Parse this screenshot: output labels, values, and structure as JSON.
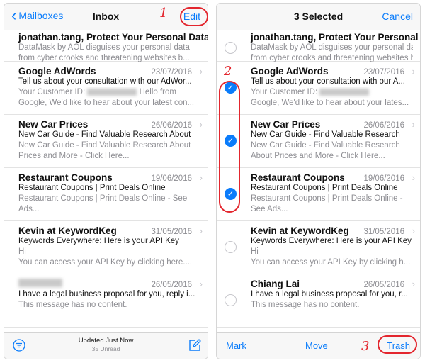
{
  "inbox": {
    "back_label": "Mailboxes",
    "title": "Inbox",
    "edit_label": "Edit",
    "messages": [
      {
        "sender": "jonathan.tang, Protect Your Personal Data",
        "date": "",
        "subject": "",
        "preview1": "DataMask by AOL disguises your personal data",
        "preview2": "from cyber crooks and threatening websites b..."
      },
      {
        "sender": "Google AdWords",
        "date": "23/07/2016",
        "subject": "Tell us about your consultation with our AdWor...",
        "preview1": "Your Customer ID:",
        "preview1b": "Hello from",
        "preview2": "Google, We'd like to hear about your latest con..."
      },
      {
        "sender": "New Car Prices",
        "date": "26/06/2016",
        "subject": "New Car Guide - Find Valuable Research About",
        "preview1": "New Car Guide - Find Valuable Research About",
        "preview2": "Prices and More - Click Here..."
      },
      {
        "sender": "Restaurant Coupons",
        "date": "19/06/2016",
        "subject": "Restaurant Coupons | Print Deals Online",
        "preview1": "Restaurant Coupons | Print Deals Online - See",
        "preview2": "Ads..."
      },
      {
        "sender": "Kevin at KeywordKeg",
        "date": "31/05/2016",
        "subject": "Keywords Everywhere: Here is your API Key",
        "preview1": "Hi",
        "preview2": "You can access your API Key by clicking here...."
      },
      {
        "sender": "",
        "date": "26/05/2016",
        "subject": "I have a legal business proposal for you, reply i...",
        "preview1": "This message has no content.",
        "preview2": ""
      }
    ],
    "toolbar": {
      "updated": "Updated Just Now",
      "unread": "35 Unread"
    }
  },
  "edit_mode": {
    "title": "3 Selected",
    "cancel_label": "Cancel",
    "messages": [
      {
        "sender": "jonathan.tang, Protect Your Personal Data",
        "date": "",
        "subject": "",
        "preview1": "DataMask by AOL disguises your personal data",
        "preview2": "from cyber crooks and threatening websites b...",
        "selected": false
      },
      {
        "sender": "Google AdWords",
        "date": "23/07/2016",
        "subject": "Tell us about your consultation with our A...",
        "preview1": "Your Customer ID:",
        "preview2": "Google, We'd like to hear about your lates...",
        "selected": true
      },
      {
        "sender": "New Car Prices",
        "date": "26/06/2016",
        "subject": "New Car Guide - Find Valuable Research",
        "preview1": "New Car Guide - Find Valuable Research",
        "preview2": "About Prices and More - Click Here...",
        "selected": true
      },
      {
        "sender": "Restaurant Coupons",
        "date": "19/06/2016",
        "subject": "Restaurant Coupons | Print Deals Online",
        "preview1": "Restaurant Coupons | Print Deals Online -",
        "preview2": "See Ads...",
        "selected": true
      },
      {
        "sender": "Kevin at KeywordKeg",
        "date": "31/05/2016",
        "subject": "Keywords Everywhere: Here is your API Key",
        "preview1": "Hi",
        "preview2": "You can access your API Key by clicking h...",
        "selected": false
      },
      {
        "sender": "Chiang Lai",
        "date": "26/05/2016",
        "subject": "I have a legal business proposal for you, r...",
        "preview1": "This message has no content.",
        "preview2": "",
        "selected": false
      }
    ],
    "toolbar": {
      "mark_label": "Mark",
      "move_label": "Move",
      "trash_label": "Trash"
    }
  },
  "annotations": {
    "step1": "1",
    "step2": "2",
    "step3": "3"
  },
  "colors": {
    "accent": "#0a7cfb",
    "annotation": "#e3262e"
  },
  "icons": {
    "filter": "filter-icon",
    "compose": "compose-icon",
    "chevron": "chevron-right-icon"
  }
}
